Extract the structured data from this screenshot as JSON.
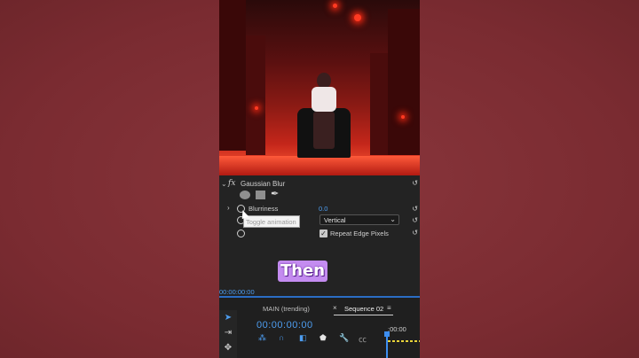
{
  "effect_panel": {
    "fx_symbol": "fx",
    "effect_name": "Gaussian Blur",
    "reset_icon": "reset-icon",
    "blurriness": {
      "label": "Blurriness",
      "value": "0.0"
    },
    "blur_dimensions": {
      "value": "Vertical"
    },
    "repeat_edge_pixels": {
      "label": "Repeat Edge Pixels",
      "checked": true
    },
    "tooltip": "Toggle animation"
  },
  "caption": "Then",
  "timeline": {
    "current_time_small": "00:00:00:00",
    "tab_main": "MAIN (trending)",
    "tab_sequence": "Sequence 02",
    "timecode": "00:00:00:00",
    "ruler_time": ":00:00"
  },
  "colors": {
    "accent": "#4d9df0",
    "caption_bg": "#c48cf0",
    "background": "#7f2f35"
  }
}
